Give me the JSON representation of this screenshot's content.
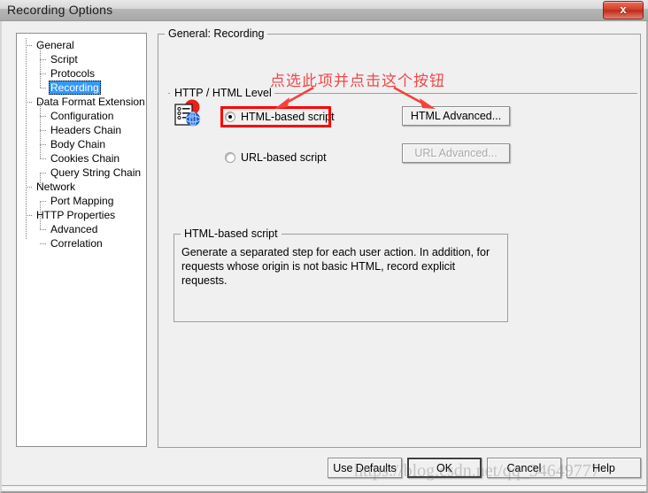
{
  "window": {
    "title": "Recording Options",
    "close_icon": "close-x-icon",
    "close_label": "x"
  },
  "tree": {
    "nodes": [
      {
        "label": "General",
        "level": 0,
        "selected": false
      },
      {
        "label": "Script",
        "level": 1,
        "selected": false
      },
      {
        "label": "Protocols",
        "level": 1,
        "selected": false
      },
      {
        "label": "Recording",
        "level": 1,
        "selected": true
      },
      {
        "label": "Data Format Extension",
        "level": 0,
        "selected": false
      },
      {
        "label": "Configuration",
        "level": 1,
        "selected": false
      },
      {
        "label": "Headers Chain",
        "level": 1,
        "selected": false
      },
      {
        "label": "Body Chain",
        "level": 1,
        "selected": false
      },
      {
        "label": "Cookies Chain",
        "level": 1,
        "selected": false
      },
      {
        "label": "Query String Chain",
        "level": 1,
        "selected": false
      },
      {
        "label": "Network",
        "level": 0,
        "selected": false
      },
      {
        "label": "Port Mapping",
        "level": 1,
        "selected": false
      },
      {
        "label": "HTTP Properties",
        "level": 0,
        "selected": false
      },
      {
        "label": "Advanced",
        "level": 1,
        "selected": false
      },
      {
        "label": "Correlation",
        "level": 1,
        "selected": false
      }
    ]
  },
  "main": {
    "group_title": "General: Recording",
    "section_label": "HTTP / HTML Level",
    "protocol_icon": "html-protocol-icon",
    "radios": [
      {
        "label": "HTML-based script",
        "selected": true,
        "highlighted": true
      },
      {
        "label": "URL-based script",
        "selected": false,
        "highlighted": false
      }
    ],
    "advanced_buttons": [
      {
        "label": "HTML Advanced...",
        "enabled": true
      },
      {
        "label": "URL Advanced...",
        "enabled": false
      }
    ],
    "description": {
      "title": "HTML-based script",
      "text": "Generate a separated step for each user action. In addition, for requests whose origin is not basic HTML, record explicit requests."
    }
  },
  "annotation": {
    "text": "点选此项并点击这个按钮",
    "color": "#f04a4a",
    "highlight_color": "#ff0000",
    "arrows": [
      {
        "name": "arrow-to-radio",
        "direction": "down-left"
      },
      {
        "name": "arrow-to-button",
        "direction": "down-right"
      }
    ]
  },
  "footer": {
    "buttons": [
      {
        "label": "Use Defaults",
        "enabled": true
      },
      {
        "label": "OK",
        "enabled": true
      },
      {
        "label": "Cancel",
        "enabled": true
      },
      {
        "label": "Help",
        "enabled": true
      }
    ]
  },
  "watermark": {
    "text": "https://blog.csdn.net/qq_34649777"
  }
}
